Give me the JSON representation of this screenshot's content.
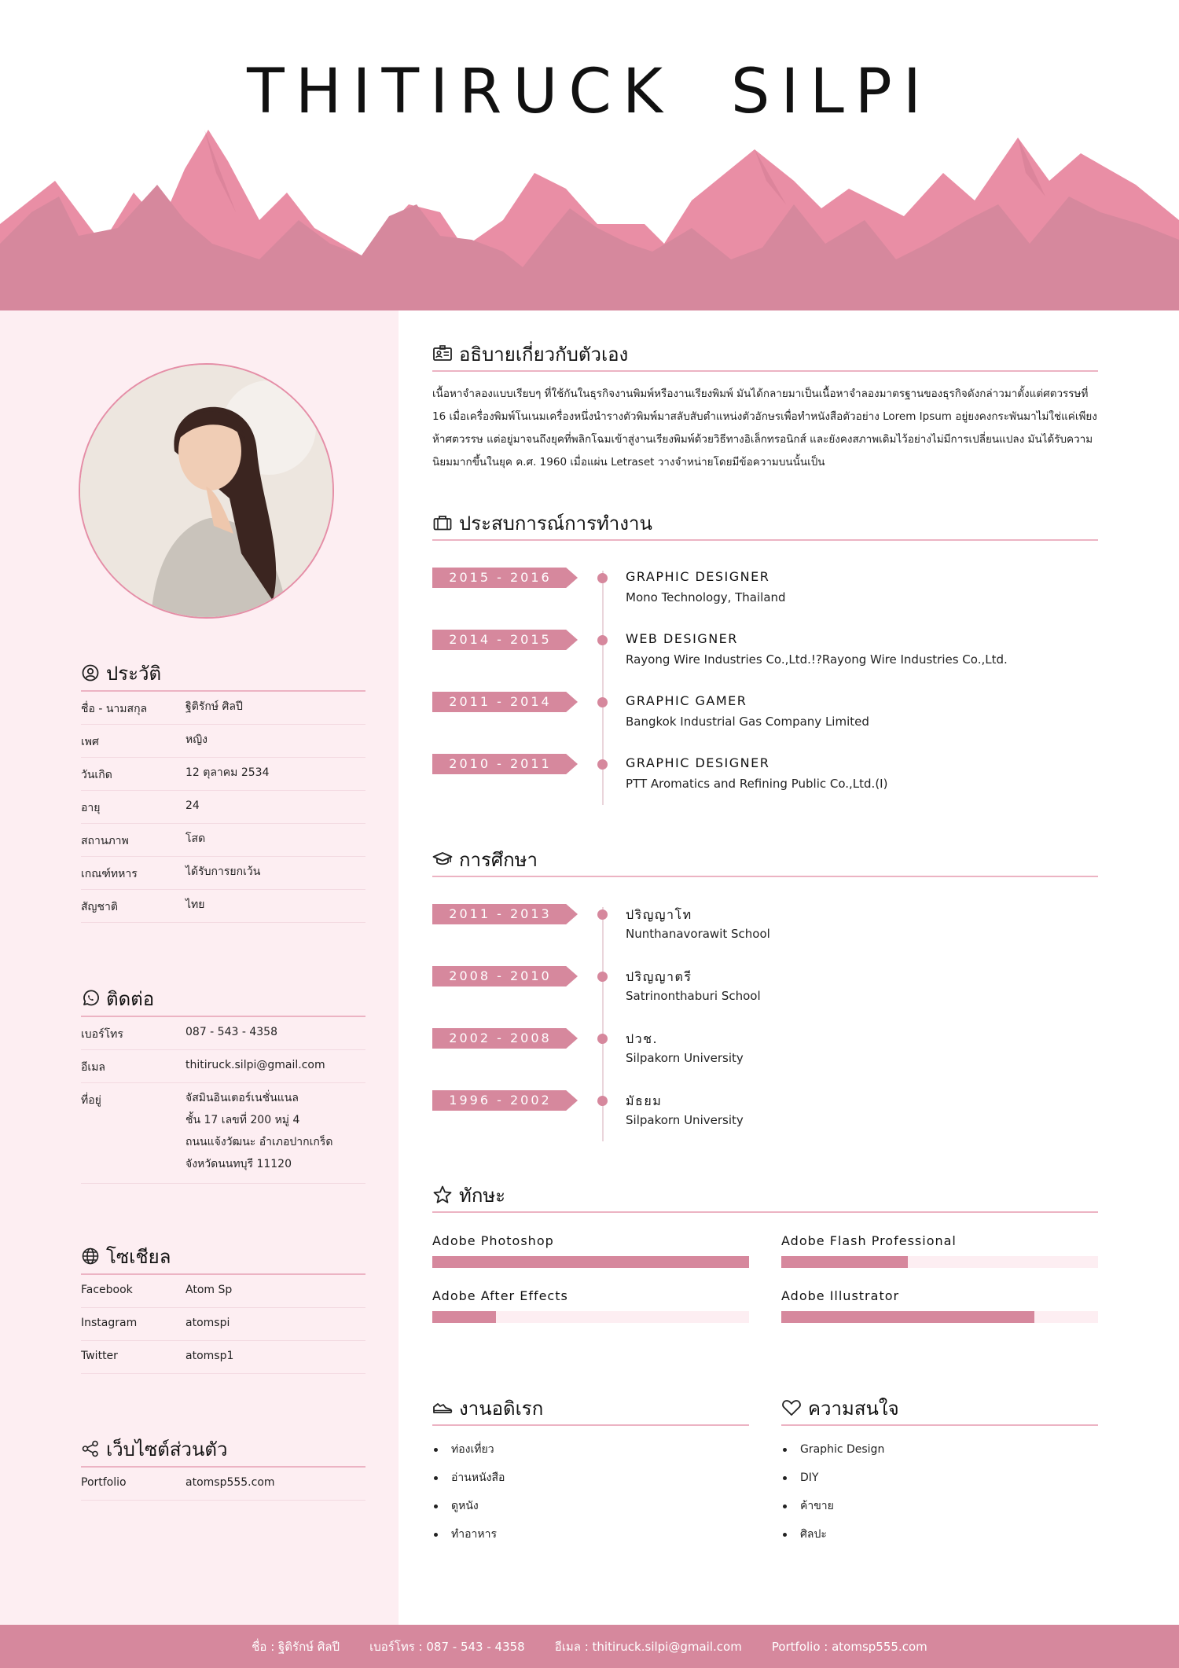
{
  "header": {
    "name": "THITIRUCK   SILPI"
  },
  "colors": {
    "accent": "#d6889d",
    "accent_light": "#fdeef2",
    "mountain_dark": "#d6889d",
    "mountain_light": "#e98ea5"
  },
  "profile": {
    "title": "ประวัติ",
    "icon": "user-circle-icon",
    "rows": [
      {
        "k": "ชื่อ - นามสกุล",
        "v": "ฐิติรักษ์ ศิลปี"
      },
      {
        "k": "เพศ",
        "v": "หญิง"
      },
      {
        "k": "วันเกิด",
        "v": "12 ตุลาคม 2534"
      },
      {
        "k": "อายุ",
        "v": "24"
      },
      {
        "k": "สถานภาพ",
        "v": "โสด"
      },
      {
        "k": "เกณฑ์ทหาร",
        "v": "ได้รับการยกเว้น"
      },
      {
        "k": "สัญชาติ",
        "v": "ไทย"
      }
    ]
  },
  "contact": {
    "title": "ติดต่อ",
    "icon": "whatsapp-icon",
    "rows": [
      {
        "k": "เบอร์โทร",
        "v": "087 - 543 - 4358"
      },
      {
        "k": "อีเมล",
        "v": "thitiruck.silpi@gmail.com"
      },
      {
        "k": "ที่อยู่",
        "v": "จัสมินอินเตอร์เนชั่นแนล\nชั้น 17 เลขที่ 200 หมู่ 4\nถนนแจ้งวัฒนะ อำเภอปากเกร็ด\nจังหวัดนนทบุรี 11120"
      }
    ]
  },
  "social": {
    "title": "โซเชียล",
    "icon": "globe-icon",
    "rows": [
      {
        "k": "Facebook",
        "v": "Atom Sp"
      },
      {
        "k": "Instagram",
        "v": "atomspi"
      },
      {
        "k": "Twitter",
        "v": "atomsp1"
      }
    ]
  },
  "website": {
    "title": "เว็บไซต์ส่วนตัว",
    "icon": "share-icon",
    "rows": [
      {
        "k": "Portfolio",
        "v": "atomsp555.com"
      }
    ]
  },
  "about": {
    "title": "อธิบายเกี่ยวกับตัวเอง",
    "icon": "id-card-icon",
    "lines": [
      "เนื้อหาจำลองแบบเรียบๆ ที่ใช้กันในธุรกิจงานพิมพ์หรืองานเรียงพิมพ์ มันได้กลายมาเป็นเนื้อหาจำลองมาตรฐานของธุรกิจดังกล่าวมาตั้งแต่ศตวรรษที่",
      "16 เมื่อเครื่องพิมพ์โนเนมเครื่องหนึ่งนำรางตัวพิมพ์มาสลับสับตำแหน่งตัวอักษรเพื่อทำหนังสือตัวอย่าง Lorem Ipsum อยู่ยงคงกระพันมาไม่ใช่แค่เพียง",
      "ห้าศตวรรษ แต่อยู่มาจนถึงยุคที่พลิกโฉมเข้าสู่งานเรียงพิมพ์ด้วยวิธีทางอิเล็กทรอนิกส์ และยังคงสภาพเดิมไว้อย่างไม่มีการเปลี่ยนแปลง มันได้รับความ",
      "นิยมมากขึ้นในยุค ค.ศ. 1960 เมื่อแผ่น Letraset วางจำหน่ายโดยมีข้อความบนนั้นเป็น"
    ]
  },
  "experience": {
    "title": "ประสบการณ์การทำงาน",
    "icon": "briefcase-icon",
    "items": [
      {
        "years": "2015 - 2016",
        "title": "GRAPHIC DESIGNER",
        "place": "Mono Technology, Thailand"
      },
      {
        "years": "2014 - 2015",
        "title": "WEB DESIGNER",
        "place": "Rayong Wire Industries Co.,Ltd.!?Rayong Wire Industries Co.,Ltd."
      },
      {
        "years": "2011 - 2014",
        "title": "GRAPHIC GAMER",
        "place": "Bangkok Industrial Gas Company Limited"
      },
      {
        "years": "2010 - 2011",
        "title": "GRAPHIC DESIGNER",
        "place": "PTT Aromatics and Refining Public Co.,Ltd.(I)"
      }
    ]
  },
  "education": {
    "title": "การศึกษา",
    "icon": "graduation-cap-icon",
    "items": [
      {
        "years": "2011 - 2013",
        "title": "ปริญญาโท",
        "place": "Nunthanavorawit School"
      },
      {
        "years": "2008 - 2010",
        "title": "ปริญญาตรี",
        "place": "Satrinonthaburi School"
      },
      {
        "years": "2002 - 2008",
        "title": "ปวช.",
        "place": "Silpakorn University"
      },
      {
        "years": "1996 - 2002",
        "title": "มัธยม",
        "place": "Silpakorn University"
      }
    ]
  },
  "skills": {
    "title": "ทักษะ",
    "icon": "star-icon",
    "items": [
      {
        "name": "Adobe Photoshop",
        "level": 1.0
      },
      {
        "name": "Adobe Flash Professional",
        "level": 0.4
      },
      {
        "name": "Adobe After Effects",
        "level": 0.2
      },
      {
        "name": "Adobe Illustrator",
        "level": 0.8
      }
    ]
  },
  "hobbies": {
    "title": "งานอดิเรก",
    "icon": "sneaker-icon",
    "items": [
      "ท่องเที่ยว",
      "อ่านหนังสือ",
      "ดูหนัง",
      "ทำอาหาร"
    ]
  },
  "interests": {
    "title": "ความสนใจ",
    "icon": "heart-icon",
    "items": [
      "Graphic Design",
      "DIY",
      "ค้าขาย",
      "ศิลปะ"
    ]
  },
  "footer": {
    "name": "ชื่อ  :  ฐิติรักษ์ ศิลปี",
    "phone": "เบอร์โทร  :  087 - 543 - 4358",
    "email": "อีเมล  :  thitiruck.silpi@gmail.com",
    "portfolio": "Portfolio  :  atomsp555.com"
  }
}
